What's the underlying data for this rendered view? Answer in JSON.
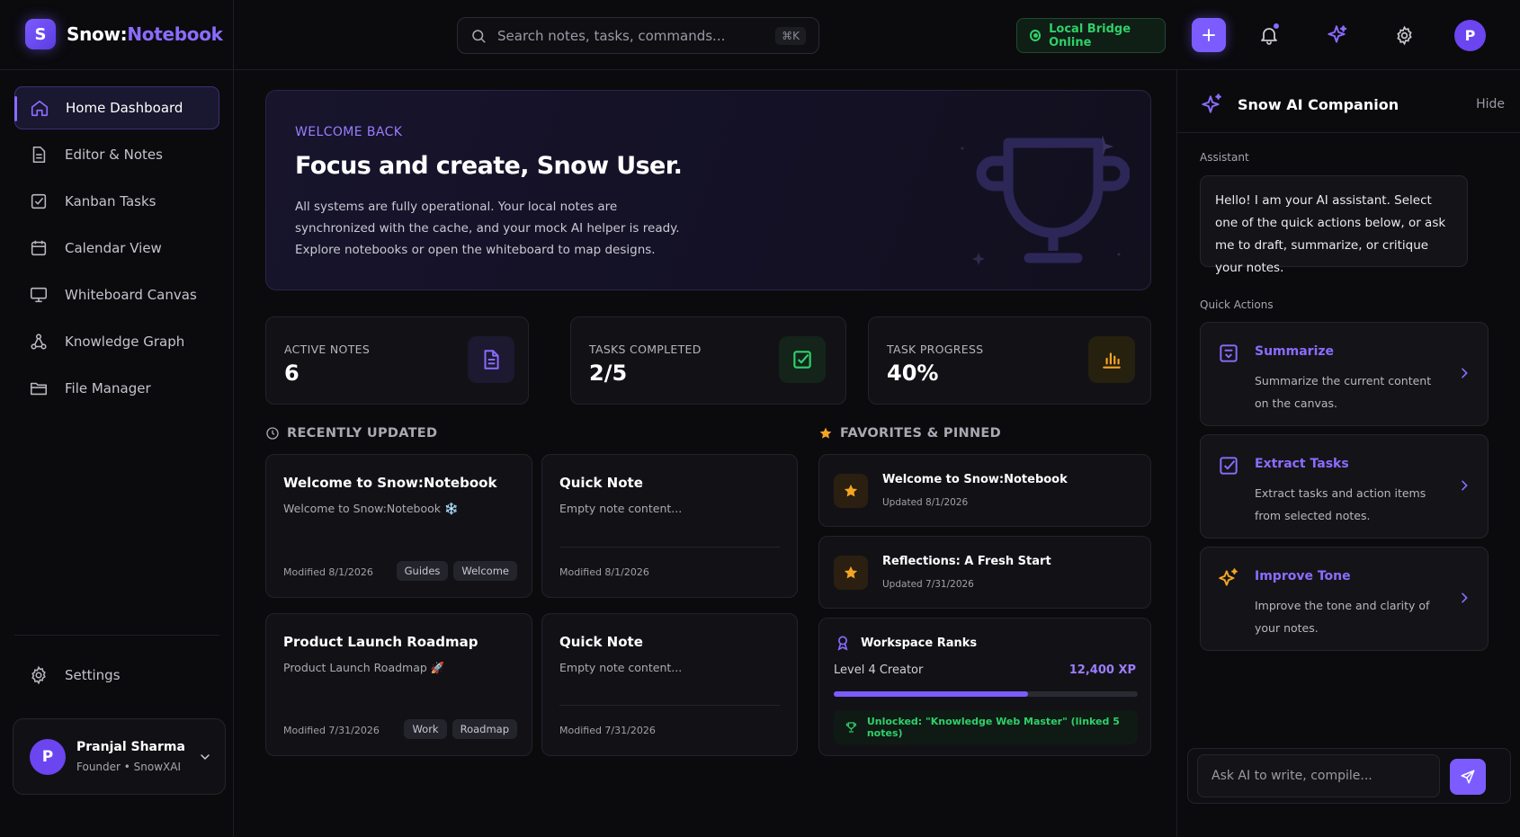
{
  "app": {
    "logo_letter": "S",
    "name_part1": "Snow:",
    "name_part2": "Notebook"
  },
  "search": {
    "placeholder": "Search notes, tasks, commands...",
    "shortcut": "⌘K"
  },
  "status": {
    "bridge_label": "Local Bridge Online",
    "bridge_color": "#2fd06a"
  },
  "topbar": {
    "avatar_letter": "P",
    "icons": [
      "search-icon",
      "plus-icon",
      "bell-icon",
      "sparkles-icon",
      "gear-icon"
    ]
  },
  "sidebar": {
    "items": [
      {
        "label": "Home Dashboard",
        "icon": "home-icon",
        "active": true
      },
      {
        "label": "Editor & Notes",
        "icon": "document-icon"
      },
      {
        "label": "Kanban Tasks",
        "icon": "checkbox-icon"
      },
      {
        "label": "Calendar View",
        "icon": "calendar-icon"
      },
      {
        "label": "Whiteboard Canvas",
        "icon": "monitor-icon"
      },
      {
        "label": "Knowledge Graph",
        "icon": "graph-icon"
      },
      {
        "label": "File Manager",
        "icon": "folder-icon"
      }
    ],
    "settings_label": "Settings",
    "user": {
      "initial": "P",
      "name": "Pranjal Sharma",
      "role": "Founder • SnowXAI"
    }
  },
  "hero": {
    "eyebrow": "WELCOME BACK",
    "title": "Focus and create, Snow User.",
    "text": "All systems are fully operational. Your local notes are synchronized with the cache, and your mock AI helper is ready. Explore notebooks or open the whiteboard to map designs."
  },
  "stats": [
    {
      "label": "ACTIVE NOTES",
      "value": "6",
      "icon": "document-icon",
      "color": "#8b6cff"
    },
    {
      "label": "TASKS COMPLETED",
      "value": "2/5",
      "icon": "checkbox-icon",
      "color": "#2fd06a"
    },
    {
      "label": "TASK PROGRESS",
      "value": "40%",
      "icon": "bar-chart-icon",
      "color": "#f5a524"
    }
  ],
  "recent": {
    "heading": "RECENTLY UPDATED",
    "notes": [
      {
        "title": "Welcome to Snow:Notebook",
        "body": "Welcome to Snow:Notebook ❄️",
        "modified": "Modified 8/1/2026",
        "tags": [
          "Guides",
          "Welcome"
        ]
      },
      {
        "title": "Quick Note",
        "body": "Empty note content...",
        "modified": "Modified 8/1/2026",
        "tags": []
      },
      {
        "title": "Product Launch Roadmap",
        "body": "Product Launch Roadmap 🚀",
        "modified": "Modified 7/31/2026",
        "tags": [
          "Work",
          "Roadmap"
        ]
      },
      {
        "title": "Quick Note",
        "body": "Empty note content...",
        "modified": "Modified 7/31/2026",
        "tags": []
      }
    ]
  },
  "favorites": {
    "heading": "FAVORITES & PINNED",
    "items": [
      {
        "title": "Welcome to Snow:Notebook",
        "updated": "Updated 8/1/2026"
      },
      {
        "title": "Reflections: A Fresh Start",
        "updated": "Updated 7/31/2026"
      }
    ]
  },
  "ranks": {
    "title": "Workspace Ranks",
    "level": "Level 4 Creator",
    "xp": "12,400 XP",
    "progress": 0.64,
    "unlock": "Unlocked: \"Knowledge Web Master\" (linked 5 notes)"
  },
  "ai_panel": {
    "title": "Snow AI Companion",
    "hide_label": "Hide",
    "assistant_label": "Assistant",
    "assistant_message": "Hello! I am your AI assistant. Select one of the quick actions below, or ask me to draft, summarize, or critique your notes.",
    "quick_actions_label": "Quick Actions",
    "actions": [
      {
        "title": "Summarize",
        "desc": "Summarize the current content on the canvas.",
        "icon": "robot-icon"
      },
      {
        "title": "Extract Tasks",
        "desc": "Extract tasks and action items from selected notes.",
        "icon": "checkbox-icon"
      },
      {
        "title": "Improve Tone",
        "desc": "Improve the tone and clarity of your notes.",
        "icon": "sparkles-icon"
      }
    ],
    "chat_placeholder": "Ask AI to write, compile..."
  },
  "colors": {
    "accent": "#7c5cff",
    "success": "#2fd06a",
    "warning": "#f5a524",
    "background": "#0b0b0e"
  }
}
